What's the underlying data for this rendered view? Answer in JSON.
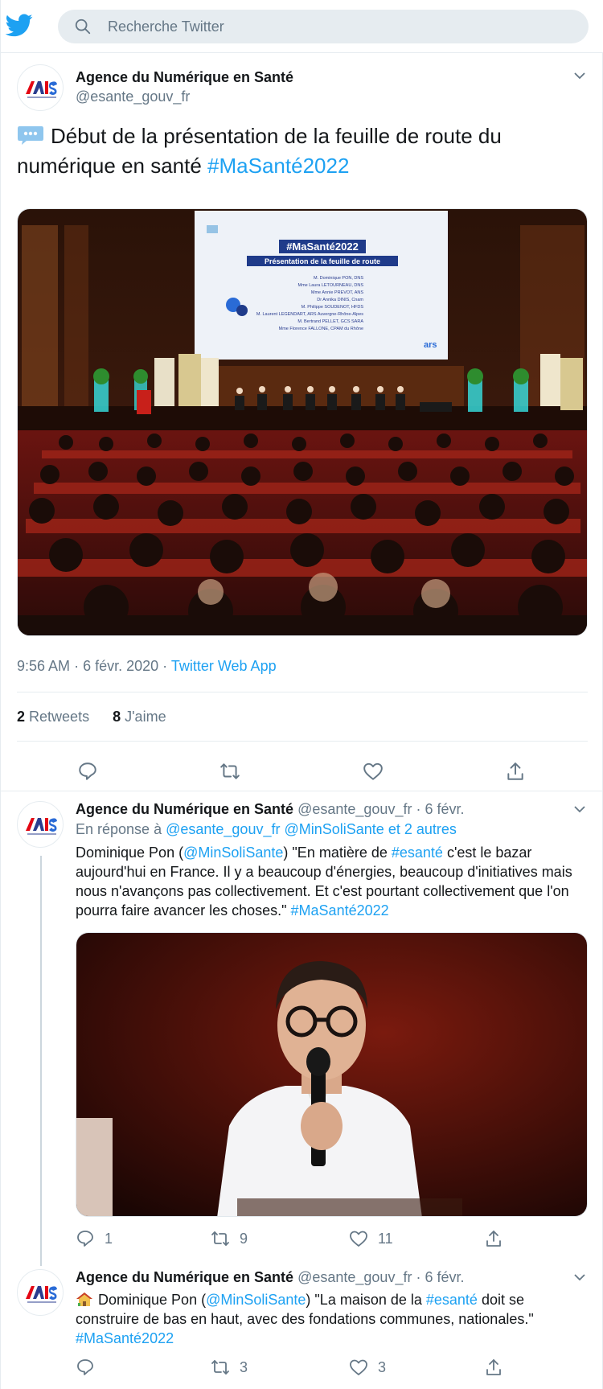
{
  "search": {
    "placeholder": "Recherche Twitter"
  },
  "main_tweet": {
    "author_name": "Agence du Numérique en Santé",
    "author_handle": "@esante_gouv_fr",
    "text_plain": "Début de la présentation de la feuille de route du numérique en santé ",
    "hashtag": "#MaSanté2022",
    "photo": {
      "screen_title": "#MaSanté2022",
      "screen_subtitle": "Présentation de la feuille de route",
      "screen_names": [
        "M. Dominique PON, DNS",
        "Mme Laura LETOURNEAU, DNS",
        "Mme Annie PREVOT, ANS",
        "Dr Annika DINIS, Cnam",
        "M. Philippe SOUDENOT, HFDS",
        "M. Laurent LEGENDART, ARS Auvergne-Rhône-Alpes",
        "M. Bertrand PELLET, GCS SARA",
        "Mme Florence FALLONE, CPAM du Rhône"
      ],
      "screen_logo": "ars"
    },
    "time": "9:56 AM",
    "dot": "·",
    "date": "6 févr. 2020",
    "source": "Twitter Web App",
    "retweets_count": "2",
    "retweets_label": "Retweets",
    "likes_count": "8",
    "likes_label": "J'aime"
  },
  "replies": [
    {
      "author_name": "Agence du Numérique en Santé",
      "author_handle": "@esante_gouv_fr",
      "dot": "·",
      "date": "6 févr.",
      "reply_prefix": "En réponse à",
      "reply_to_1": "@esante_gouv_fr",
      "reply_to_2": "@MinSoliSante",
      "reply_others": "et 2 autres",
      "text": {
        "t1": "Dominique Pon (",
        "m1": "@MinSoliSante",
        "t2": ") \"En matière de ",
        "h1": "#esanté",
        "t3": " c'est le bazar aujourd'hui en France. Il y a beaucoup d'énergies, beaucoup d'initiatives mais nous n'avançons pas collectivement. Et c'est pourtant collectivement que l'on pourra faire avancer les choses.\" ",
        "h2": "#MaSanté2022"
      },
      "replies_count": "1",
      "retweets_count": "9",
      "likes_count": "11"
    },
    {
      "author_name": "Agence du Numérique en Santé",
      "author_handle": "@esante_gouv_fr",
      "dot": "·",
      "date": "6 févr.",
      "text": {
        "t1": "Dominique Pon (",
        "m1": "@MinSoliSante",
        "t2": ") \"La maison de la ",
        "h1": "#esanté",
        "t3": " doit se construire de bas en haut, avec des fondations communes, nationales.\" ",
        "h2": "#MaSanté2022"
      },
      "replies_count": "",
      "retweets_count": "3",
      "likes_count": "3"
    }
  ],
  "colors": {
    "accent": "#1da1f2",
    "secondary_text": "#657786",
    "border": "#e6ecf0",
    "primary_text": "#14171a"
  },
  "icons": [
    "twitter-bird-icon",
    "search-icon",
    "chevron-down-icon",
    "speech-bubble-emoji",
    "reply-icon",
    "retweet-icon",
    "like-icon",
    "share-icon",
    "house-emoji"
  ]
}
